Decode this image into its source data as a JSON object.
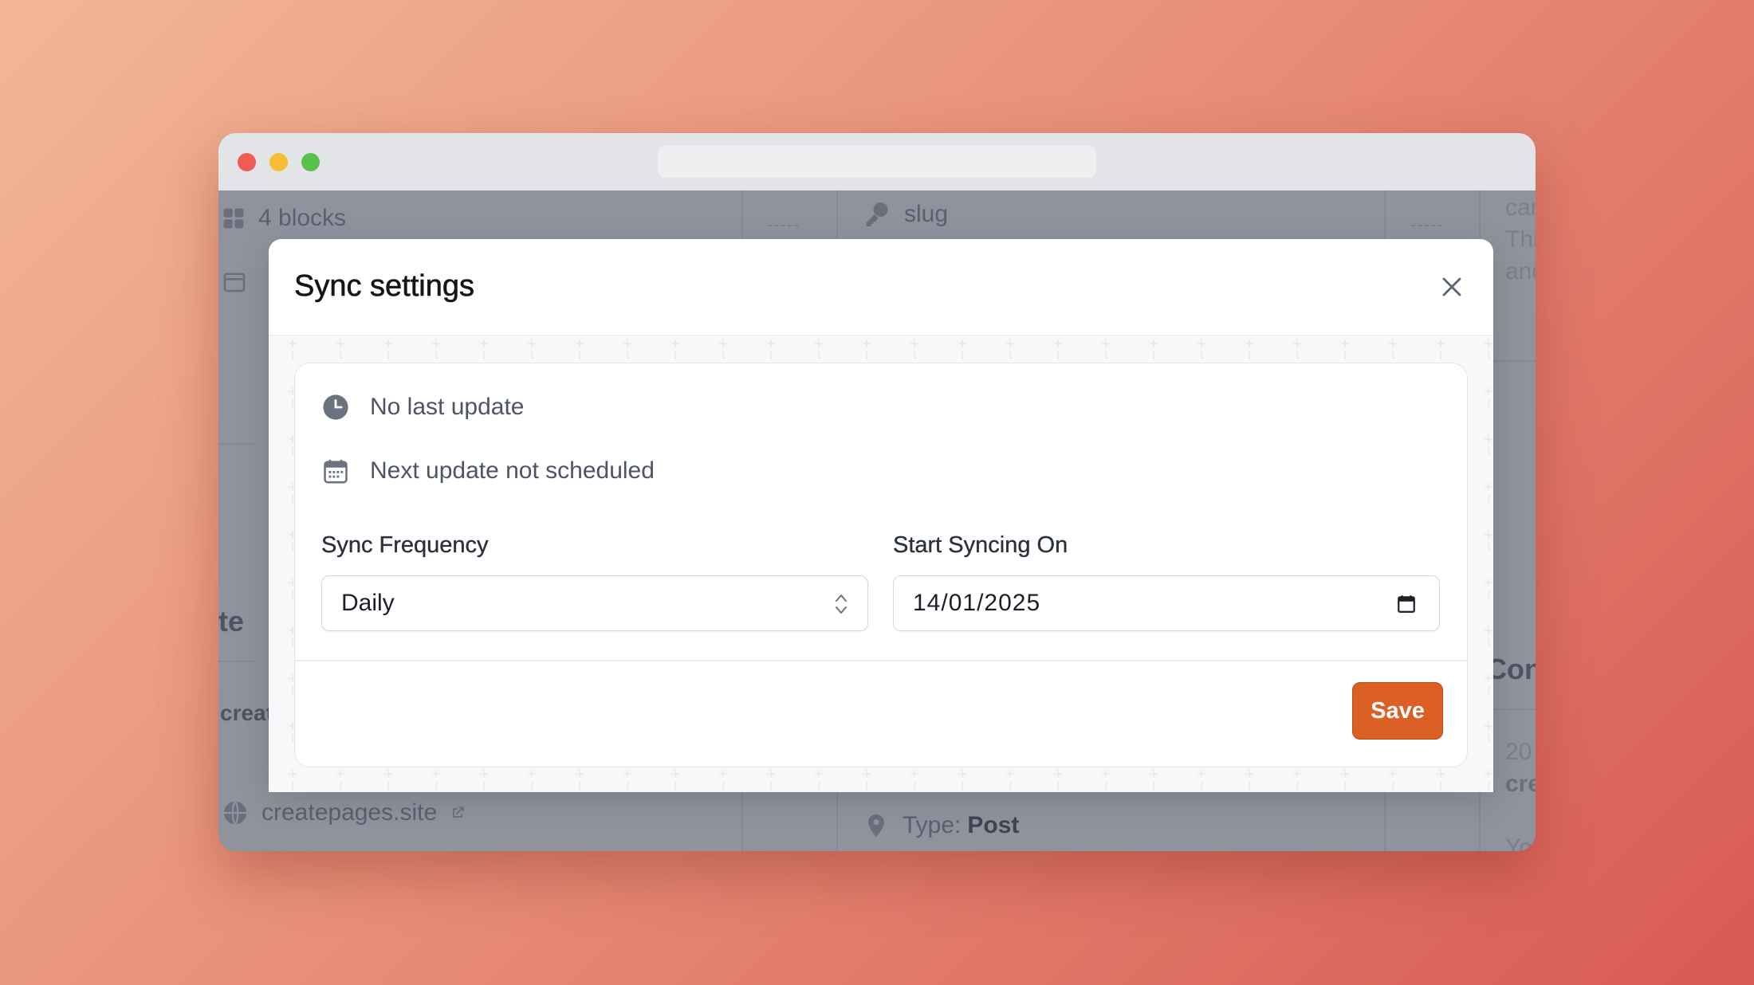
{
  "background_app": {
    "blocks_label": "4 blocks",
    "slug_label": "slug",
    "side_fragment_te": "te",
    "side_fragment_creat": "creat",
    "site_link": "createpages.site",
    "type_prefix": "Type:",
    "type_value": "Post",
    "right_fragment_1": "car",
    "right_fragment_2": "Thi",
    "right_fragment_3": "anc",
    "right_fragment_con": "Con",
    "right_fragment_20": "20",
    "right_fragment_cre": "cre",
    "right_fragment_yo": "Yo",
    "dashes": "-----"
  },
  "modal": {
    "title": "Sync settings",
    "last_update": "No last update",
    "next_update": "Next update not scheduled",
    "frequency_label": "Sync Frequency",
    "frequency_value": "Daily",
    "start_label": "Start Syncing On",
    "start_value": "14/01/2025",
    "save_label": "Save"
  },
  "colors": {
    "accent": "#dc5f23",
    "background_gradient_start": "#f2b695",
    "background_gradient_end": "#d85a55"
  },
  "icons": [
    "clock-icon",
    "calendar-icon",
    "chevron-updown-icon",
    "close-icon",
    "grid-icon",
    "key-icon",
    "globe-icon",
    "external-link-icon",
    "pin-icon"
  ]
}
